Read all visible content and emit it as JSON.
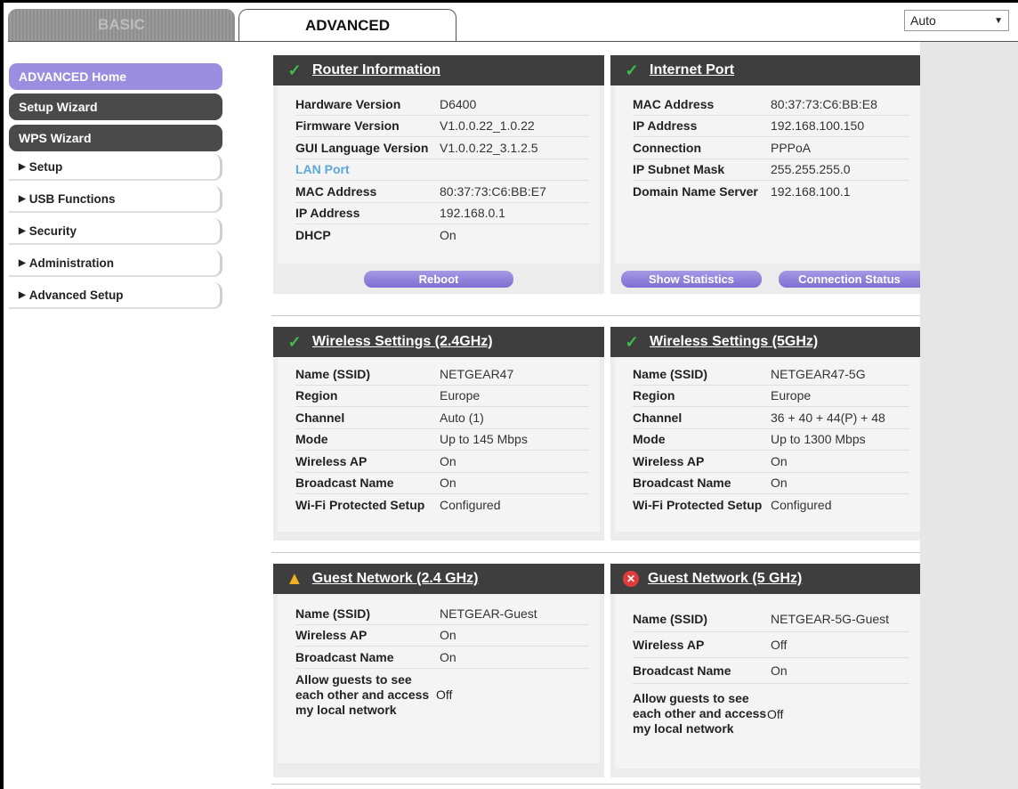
{
  "tabs": {
    "basic": "BASIC",
    "advanced": "ADVANCED"
  },
  "language": {
    "selected": "Auto"
  },
  "sidebar": {
    "home": "ADVANCED Home",
    "setup_wizard": "Setup Wizard",
    "wps_wizard": "WPS Wizard",
    "items": [
      "Setup",
      "USB Functions",
      "Security",
      "Administration",
      "Advanced Setup"
    ]
  },
  "router_info": {
    "title": "Router Information",
    "rows": [
      {
        "k": "Hardware Version",
        "v": "D6400"
      },
      {
        "k": "Firmware Version",
        "v": "V1.0.0.22_1.0.22"
      },
      {
        "k": "GUI Language Version",
        "v": "V1.0.0.22_3.1.2.5"
      }
    ],
    "lan_port": "LAN Port",
    "lan_rows": [
      {
        "k": "MAC Address",
        "v": "80:37:73:C6:BB:E7"
      },
      {
        "k": "IP Address",
        "v": "192.168.0.1"
      },
      {
        "k": "DHCP",
        "v": "On"
      }
    ],
    "reboot": "Reboot"
  },
  "internet_port": {
    "title": "Internet Port",
    "rows": [
      {
        "k": "MAC Address",
        "v": "80:37:73:C6:BB:E8"
      },
      {
        "k": "IP Address",
        "v": "192.168.100.150"
      },
      {
        "k": "Connection",
        "v": "PPPoA"
      },
      {
        "k": "IP Subnet Mask",
        "v": "255.255.255.0"
      },
      {
        "k": "Domain Name Server",
        "v": "192.168.100.1"
      }
    ],
    "show_statistics": "Show Statistics",
    "connection_status": "Connection Status"
  },
  "wireless_24": {
    "title": "Wireless Settings (2.4GHz)",
    "rows": [
      {
        "k": "Name (SSID)",
        "v": "NETGEAR47"
      },
      {
        "k": "Region",
        "v": "Europe"
      },
      {
        "k": "Channel",
        "v": "Auto (1)"
      },
      {
        "k": "Mode",
        "v": "Up to 145 Mbps"
      },
      {
        "k": "Wireless AP",
        "v": "On"
      },
      {
        "k": "Broadcast Name",
        "v": "On"
      },
      {
        "k": "Wi-Fi Protected Setup",
        "v": "Configured"
      }
    ]
  },
  "wireless_5": {
    "title": "Wireless Settings (5GHz)",
    "rows": [
      {
        "k": "Name (SSID)",
        "v": "NETGEAR47-5G"
      },
      {
        "k": "Region",
        "v": "Europe"
      },
      {
        "k": "Channel",
        "v": "36 + 40 + 44(P) + 48"
      },
      {
        "k": "Mode",
        "v": "Up to 1300 Mbps"
      },
      {
        "k": "Wireless AP",
        "v": "On"
      },
      {
        "k": "Broadcast Name",
        "v": "On"
      },
      {
        "k": "Wi-Fi Protected Setup",
        "v": "Configured"
      }
    ]
  },
  "guest_24": {
    "title": "Guest Network (2.4 GHz)",
    "rows": [
      {
        "k": "Name (SSID)",
        "v": "NETGEAR-Guest"
      },
      {
        "k": "Wireless AP",
        "v": "On"
      },
      {
        "k": "Broadcast Name",
        "v": "On"
      }
    ],
    "allow_l1": "Allow guests to see",
    "allow_l2": "each other and access",
    "allow_l3": "my local network",
    "allow_v": "Off"
  },
  "guest_5": {
    "title": "Guest Network (5 GHz)",
    "rows": [
      {
        "k": "Name (SSID)",
        "v": "NETGEAR-5G-Guest"
      },
      {
        "k": "Wireless AP",
        "v": "Off"
      },
      {
        "k": "Broadcast Name",
        "v": "On"
      }
    ],
    "allow_l1": "Allow guests to see",
    "allow_l2": "each other and access",
    "allow_l3": "my local network",
    "allow_v": "Off"
  },
  "colors": {
    "accent": "#9b8de0",
    "header": "#3e3e3e",
    "ok": "#3ec14a",
    "warn": "#f0b020",
    "error": "#e03c3c"
  }
}
